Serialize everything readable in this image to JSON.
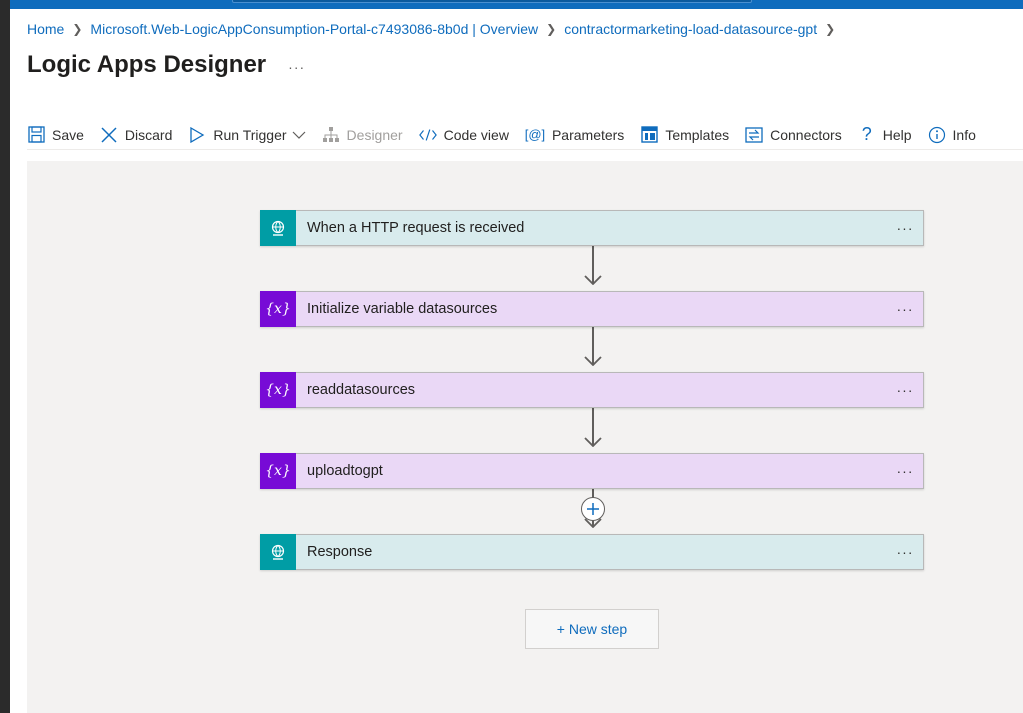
{
  "breadcrumb": [
    {
      "label": "Home"
    },
    {
      "label": "Microsoft.Web-LogicAppConsumption-Portal-c7493086-8b0d | Overview"
    },
    {
      "label": "contractormarketing-load-datasource-gpt"
    }
  ],
  "page": {
    "title": "Logic Apps Designer",
    "more": "···"
  },
  "toolbar": {
    "save": "Save",
    "discard": "Discard",
    "run_trigger": "Run Trigger",
    "designer": "Designer",
    "code_view": "Code view",
    "parameters": "Parameters",
    "templates": "Templates",
    "connectors": "Connectors",
    "help": "Help",
    "info": "Info"
  },
  "steps": [
    {
      "label": "When a HTTP request is received",
      "kind": "http",
      "icon": "globe-icon"
    },
    {
      "label": "Initialize variable datasources",
      "kind": "variable",
      "icon": "variable-icon"
    },
    {
      "label": "readdatasources",
      "kind": "variable",
      "icon": "variable-icon"
    },
    {
      "label": "uploadtogpt",
      "kind": "variable",
      "icon": "variable-icon"
    },
    {
      "label": "Response",
      "kind": "http",
      "icon": "globe-icon"
    }
  ],
  "step_more": "···",
  "variable_icon_text": "{x}",
  "new_step": "+ New step",
  "colors": {
    "accent": "#0f6cbd",
    "http_badge": "#009da5",
    "http_bg": "#d8ebed",
    "variable_badge": "#770bd6",
    "variable_bg": "#ead8f6",
    "canvas": "#f3f2f1"
  }
}
